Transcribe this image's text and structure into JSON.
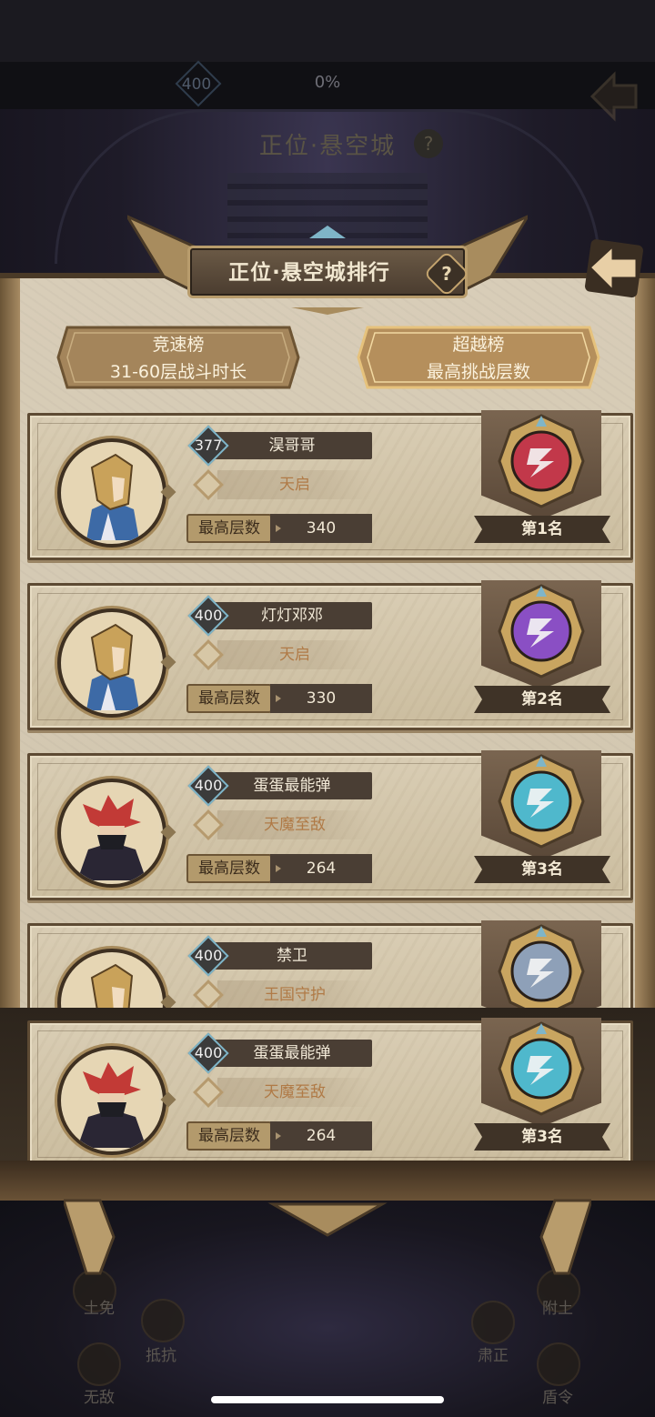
{
  "background": {
    "level": "400",
    "progress": "0%",
    "stage_title": "正位·悬空城",
    "help_glyph": "?",
    "bottom_labels": [
      "土免",
      "抵抗",
      "无敌",
      "肃正",
      "附土",
      "盾令"
    ]
  },
  "modal": {
    "title": "正位·悬空城排行",
    "help_glyph": "?",
    "back_icon": "back-arrow-icon"
  },
  "tabs": [
    {
      "label": "竞速榜",
      "sub": "31-60层战斗时长",
      "active": false
    },
    {
      "label": "超越榜",
      "sub": "最高挑战层数",
      "active": true
    }
  ],
  "stat_label": "最高层数",
  "entries": [
    {
      "level": "377",
      "name": "淏哥哥",
      "guild": "天启",
      "value": "340",
      "rank": "第1名",
      "avatar": "gold-helmet-knight",
      "medal": "red-crest-medal",
      "medal_color": "#c2384a"
    },
    {
      "level": "400",
      "name": "灯灯邓邓",
      "guild": "天启",
      "value": "330",
      "rank": "第2名",
      "avatar": "gold-helmet-knight",
      "medal": "purple-crest-medal",
      "medal_color": "#8a4fc4"
    },
    {
      "level": "400",
      "name": "蛋蛋最能弹",
      "guild": "天魔至敌",
      "value": "264",
      "rank": "第3名",
      "avatar": "red-haired-masked-rogue",
      "medal": "cyan-crest-medal",
      "medal_color": "#4fb8cc"
    },
    {
      "level": "400",
      "name": "禁卫",
      "guild": "王国守护",
      "value": "",
      "rank": "",
      "avatar": "gold-helmet-knight",
      "medal": "steel-crest-medal",
      "medal_color": "#8ea0b8"
    }
  ],
  "self_entry": {
    "level": "400",
    "name": "蛋蛋最能弹",
    "guild": "天魔至敌",
    "value": "264",
    "rank": "第3名",
    "avatar": "red-haired-masked-rogue",
    "medal": "cyan-crest-medal",
    "medal_color": "#4fb8cc"
  }
}
